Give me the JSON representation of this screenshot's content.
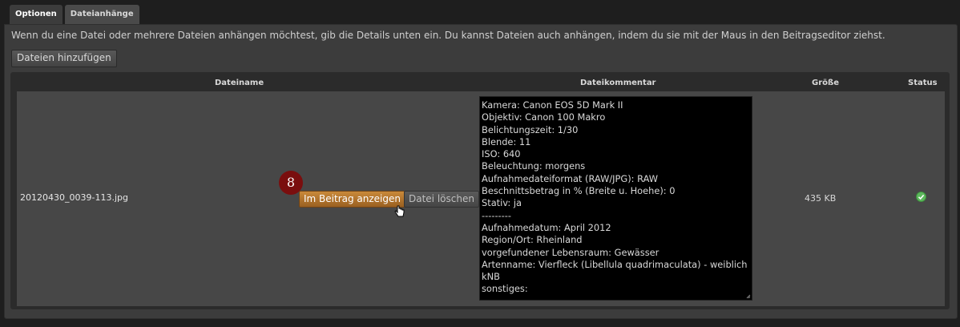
{
  "tabs": [
    {
      "label": "Optionen",
      "active": true
    },
    {
      "label": "Dateianhänge",
      "active": false
    }
  ],
  "info_text": "Wenn du eine Datei oder mehrere Dateien anhängen möchtest, gib die Details unten ein. Du kannst Dateien auch anhängen, indem du sie mit der Maus in den Beitragseditor ziehst.",
  "add_files_label": "Dateien hinzufügen",
  "table": {
    "columns": [
      "Dateiname",
      "Dateikommentar",
      "Größe",
      "Status"
    ],
    "row": {
      "filename": "20120430_0039-113.jpg",
      "step_badge": "8",
      "show_in_post_label": "Im Beitrag anzeigen",
      "delete_label": "Datei löschen",
      "comment_lines": [
        "Kamera: Canon EOS 5D Mark II",
        "Objektiv: Canon 100 Makro",
        "Belichtungszeit: 1/30",
        "Blende: 11",
        "ISO: 640",
        "Beleuchtung: morgens",
        "Aufnahmedateiformat (RAW/JPG): RAW",
        "Beschnittsbetrag in % (Breite u. Hoehe): 0",
        "Stativ: ja",
        "---------",
        "Aufnahmedatum: April 2012",
        "Region/Ort: Rheinland",
        "vorgefundener Lebensraum: Gewässer",
        "Artenname: Vierfleck (Libellula quadrimaculata) - weiblich",
        "kNB",
        "sonstiges:"
      ],
      "size": "435 KB",
      "status_icon": "check-circle-icon"
    }
  },
  "colors": {
    "accent_button": "#b0742c",
    "badge": "#7a0e0e",
    "status_ok": "#5cb85c"
  }
}
